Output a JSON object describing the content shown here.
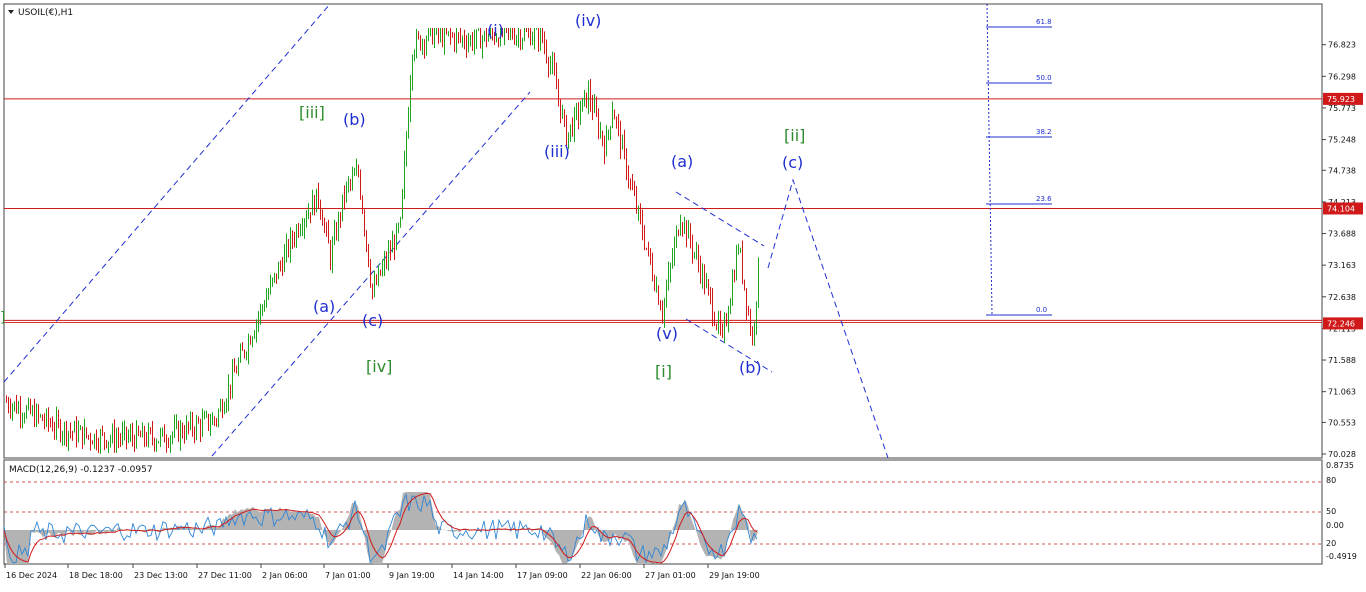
{
  "chart_data": {
    "type": "candlestick",
    "symbol_label": "USOIL(€),H1",
    "price_axis": {
      "min": 70.028,
      "max": 77.1,
      "ticks": [
        "76.823",
        "76.298",
        "75.773",
        "75.248",
        "74.738",
        "74.213",
        "73.688",
        "73.163",
        "72.638",
        "72.113",
        "71.588",
        "71.063",
        "70.553",
        "70.028"
      ],
      "marked_levels": [
        {
          "label": "75.923",
          "value": 75.923
        },
        {
          "label": "74.104",
          "value": 74.104
        },
        {
          "label": "72.246",
          "value": 72.246
        }
      ]
    },
    "time_axis": [
      "16 Dec 2024",
      "18 Dec 18:00",
      "23 Dec 13:00",
      "27 Dec 11:00",
      "2 Jan 06:00",
      "7 Jan 01:00",
      "9 Jan 19:00",
      "14 Jan 14:00",
      "17 Jan 09:00",
      "22 Jan 06:00",
      "27 Jan 01:00",
      "29 Jan 19:00"
    ],
    "fibonacci": [
      "61.8",
      "50.0",
      "38.2",
      "23.6",
      "0.0"
    ],
    "wave_labels": [
      {
        "text": "[iii]",
        "color": "#2e8b2e"
      },
      {
        "text": "(b)",
        "color": "#1f2fd1"
      },
      {
        "text": "(a)",
        "color": "#1f2fd1"
      },
      {
        "text": "(c)",
        "color": "#1f2fd1"
      },
      {
        "text": "[iv]",
        "color": "#2e8b2e"
      },
      {
        "text": "(i)",
        "color": "#1f2fd1"
      },
      {
        "text": "(iv)",
        "color": "#1f2fd1"
      },
      {
        "text": "(iii)",
        "color": "#1f2fd1"
      },
      {
        "text": "(a)",
        "color": "#1f2fd1"
      },
      {
        "text": "(v)",
        "color": "#1f2fd1"
      },
      {
        "text": "[i]",
        "color": "#2e8b2e"
      },
      {
        "text": "(b)",
        "color": "#1f2fd1"
      },
      {
        "text": "[ii]",
        "color": "#2e8b2e"
      },
      {
        "text": "(c)",
        "color": "#1f2fd1"
      }
    ],
    "macd": {
      "label": "MACD(12,26,9) -0.1237 -0.0957",
      "axis_labels": [
        "0.8735",
        "80",
        "50",
        "0.00",
        "20",
        "-0.4919"
      ]
    },
    "colors": {
      "bull": "#1fa51f",
      "bear": "#d01a1a",
      "level_line": "#d01a1a",
      "wave_blue": "#1f2fd1",
      "wave_green": "#2e8b2e",
      "trend": "#1f2fd1",
      "macd_hist": "#b3b3b3",
      "macd_main": "#2f86d6",
      "macd_signal": "#d01a1a"
    }
  }
}
